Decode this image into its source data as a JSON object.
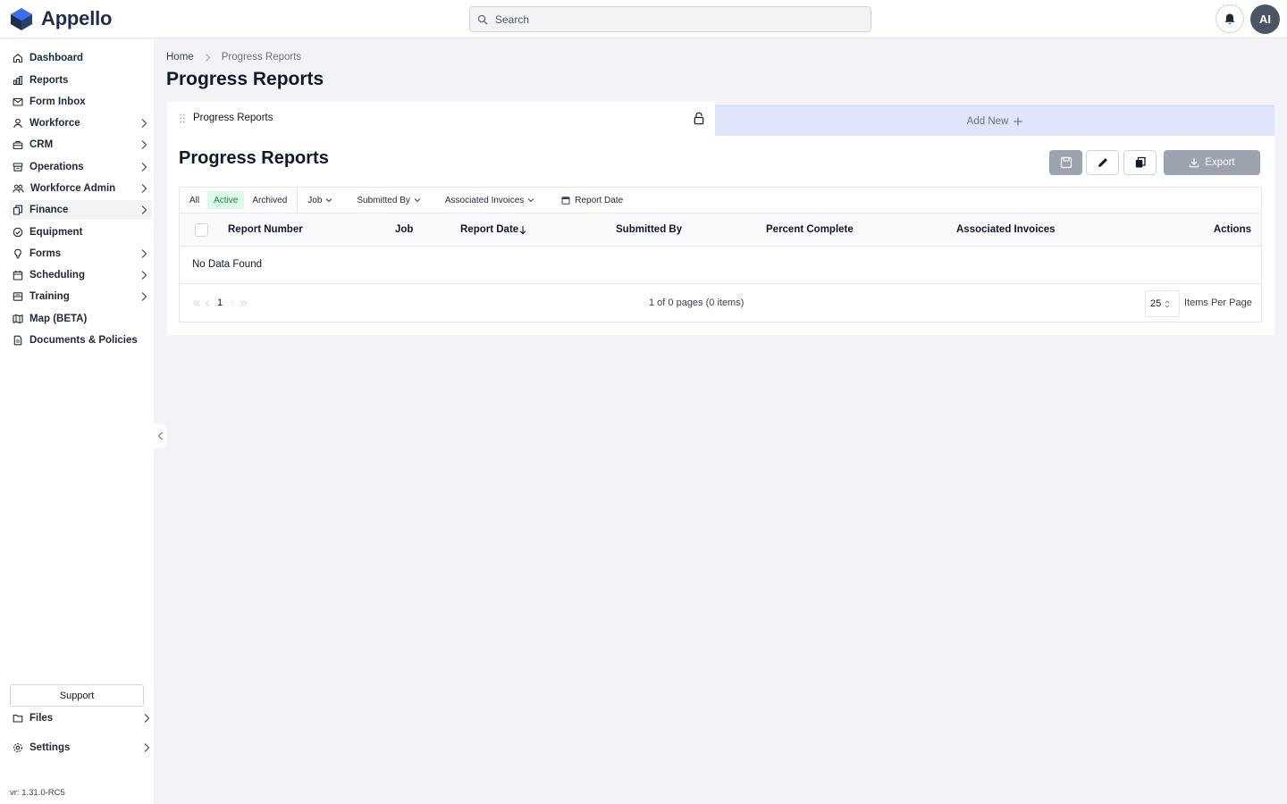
{
  "app": {
    "name": "Appello"
  },
  "header": {
    "search_placeholder": "Search",
    "avatar_initials": "AI"
  },
  "sidebar": {
    "items": [
      {
        "label": "Dashboard",
        "icon": "home-icon",
        "has_children": false
      },
      {
        "label": "Reports",
        "icon": "bar-chart-icon",
        "has_children": false
      },
      {
        "label": "Form Inbox",
        "icon": "mail-icon",
        "has_children": false
      },
      {
        "label": "Workforce",
        "icon": "user-icon",
        "has_children": true
      },
      {
        "label": "CRM",
        "icon": "briefcase-icon",
        "has_children": true
      },
      {
        "label": "Operations",
        "icon": "layers-icon",
        "has_children": true
      },
      {
        "label": "Workforce Admin",
        "icon": "users-icon",
        "has_children": true
      },
      {
        "label": "Finance",
        "icon": "copy-icon",
        "has_children": true,
        "active": true
      },
      {
        "label": "Equipment",
        "icon": "gauge-icon",
        "has_children": false
      },
      {
        "label": "Forms",
        "icon": "lightbulb-icon",
        "has_children": true
      },
      {
        "label": "Scheduling",
        "icon": "calendar-icon",
        "has_children": true
      },
      {
        "label": "Training",
        "icon": "training-icon",
        "has_children": true
      },
      {
        "label": "Map (BETA)",
        "icon": "map-icon",
        "has_children": false
      },
      {
        "label": "Documents & Policies",
        "icon": "document-icon",
        "has_children": false
      }
    ],
    "support_label": "Support",
    "files_label": "Files",
    "settings_label": "Settings",
    "version": "vr: 1.31.0-RC5"
  },
  "breadcrumb": {
    "home": "Home",
    "current": "Progress Reports"
  },
  "page_title": "Progress Reports",
  "tabs": {
    "active_label": "Progress Reports",
    "add_label": "Add New"
  },
  "panel": {
    "title": "Progress Reports",
    "export_label": "Export",
    "filters": {
      "segments": [
        "All",
        "Active",
        "Archived"
      ],
      "active_segment": "Active",
      "dropdowns": [
        "Job",
        "Submitted By",
        "Associated Invoices"
      ],
      "date_label": "Report Date"
    },
    "columns": [
      "Report Number",
      "Job",
      "Report Date",
      "Submitted By",
      "Percent Complete",
      "Associated Invoices",
      "Actions"
    ],
    "sort_column": "Report Date",
    "empty_text": "No Data Found",
    "pagination": {
      "current_page": "1",
      "info": "1 of 0 pages (0 items)",
      "per_page": "25",
      "per_page_label": "Items Per Page"
    }
  },
  "colors": {
    "brand": "#2563eb",
    "active_segment_bg": "#dcfce7",
    "active_segment_text": "#15803d",
    "add_tab_bg": "#dfe5fb",
    "disabled_button": "#9ca3af"
  }
}
